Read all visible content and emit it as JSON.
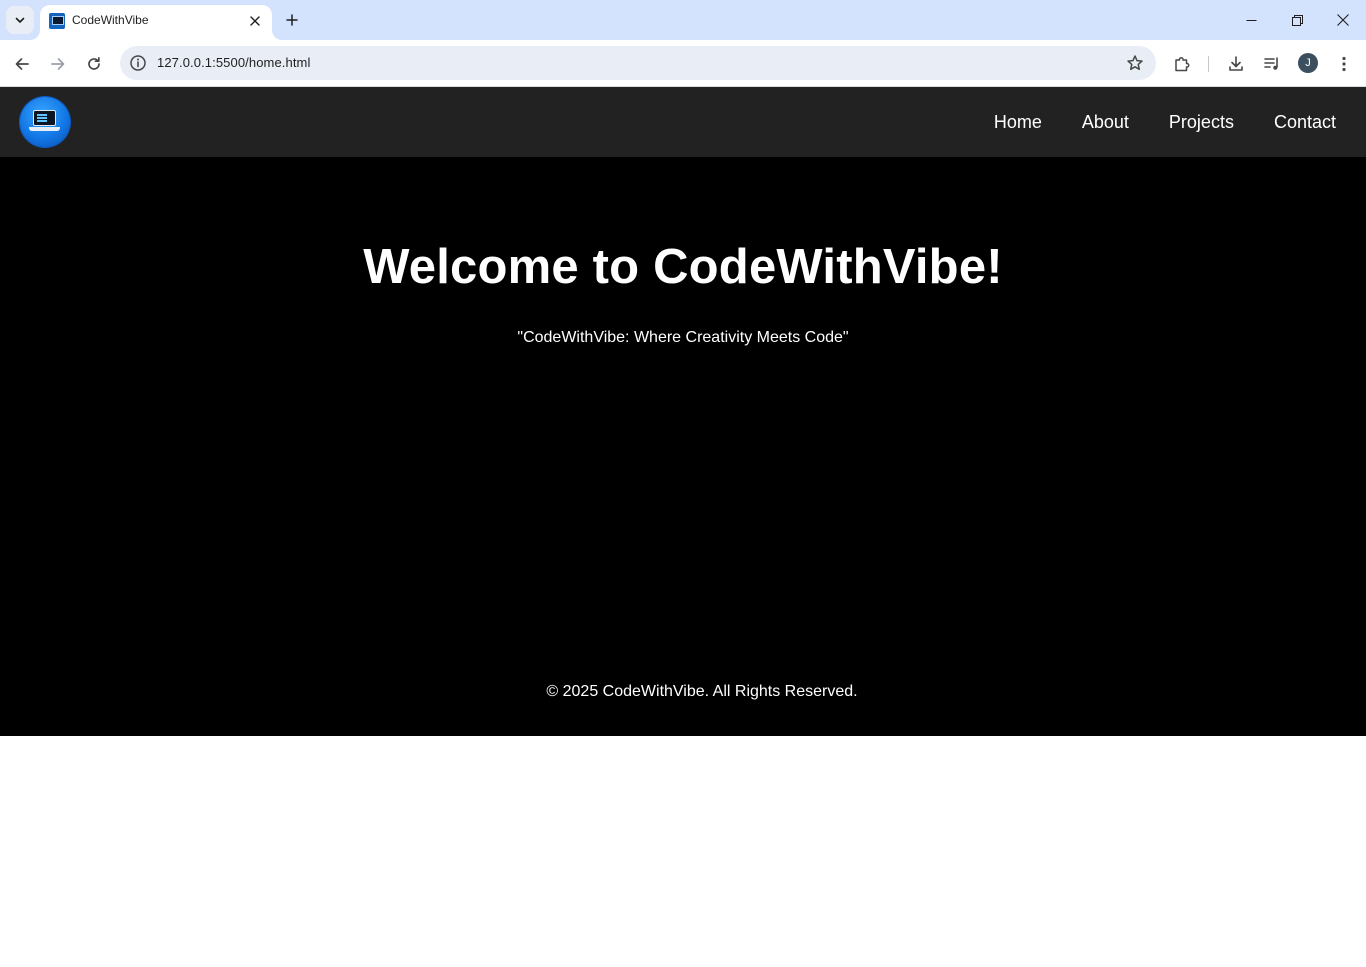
{
  "browser": {
    "tab": {
      "title": "CodeWithVibe"
    },
    "address_bar": {
      "url": "127.0.0.1:5500/home.html"
    },
    "profile_initial": "J"
  },
  "site": {
    "nav": [
      "Home",
      "About",
      "Projects",
      "Contact"
    ],
    "hero": {
      "title": "Welcome to CodeWithVibe!",
      "tagline": "\"CodeWithVibe: Where Creativity Meets Code\""
    },
    "footer": "© 2025 CodeWithVibe. All Rights Reserved."
  },
  "colors": {
    "tab_strip": "#d3e3fd",
    "header_bg": "#222222",
    "hero_bg": "#000000",
    "logo_blue": "#1277e6"
  },
  "icons": [
    "tab-search-icon",
    "close-icon",
    "plus-icon",
    "minimize-icon",
    "restore-icon",
    "back-icon",
    "forward-icon",
    "reload-icon",
    "site-info-icon",
    "star-icon",
    "extensions-icon",
    "download-icon",
    "media-controls-icon",
    "more-vert-icon"
  ]
}
